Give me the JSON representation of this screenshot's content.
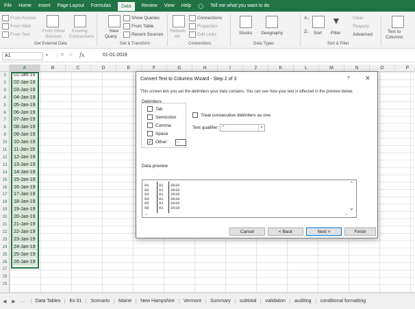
{
  "ribbon_tabs": [
    "File",
    "Home",
    "Insert",
    "Page Layout",
    "Formulas",
    "Data",
    "Review",
    "View",
    "Help"
  ],
  "tellme": "Tell me what you want to do",
  "ribbon": {
    "from_access": "From Access",
    "from_web": "From Web",
    "from_text": "From Text",
    "from_other": "From Other",
    "sources": "Sources",
    "existing": "Existing",
    "connections_btn": "Connections",
    "new_query": "New",
    "query": "Query",
    "show_queries": "Show Queries",
    "from_table": "From Table",
    "recent_sources": "Recent Sources",
    "refresh": "Refresh",
    "all": "All",
    "connections": "Connections",
    "properties": "Properties",
    "edit_links": "Edit Links",
    "stocks": "Stocks",
    "geography": "Geography",
    "sort": "Sort",
    "filter": "Filter",
    "clear": "Clear",
    "reapply": "Reapply",
    "advanced": "Advanced",
    "text_to": "Text to",
    "columns": "Columns",
    "group_get_external": "Get External Data",
    "group_get_transform": "Get & Transform",
    "group_connections": "Connections",
    "group_data_types": "Data Types",
    "group_sort_filter": "Sort & Filter"
  },
  "namebox": "A1",
  "formula_value": "01-01-2019",
  "columns": [
    "A",
    "B",
    "C",
    "D",
    "E",
    "F",
    "G",
    "H",
    "I",
    "J",
    "K",
    "L",
    "M",
    "N",
    "O",
    "P"
  ],
  "rows": [
    "1",
    "2",
    "3",
    "4",
    "5",
    "6",
    "7",
    "8",
    "9",
    "10",
    "11",
    "12",
    "13",
    "14",
    "15",
    "16",
    "17",
    "18",
    "19",
    "20",
    "21",
    "22",
    "23",
    "24",
    "25",
    "26",
    "27",
    "28",
    "29"
  ],
  "cells": [
    "01-Jan-19",
    "02-Jan-19",
    "03-Jan-19",
    "04-Jan-19",
    "05-Jan-19",
    "06-Jan-19",
    "07-Jan-19",
    "08-Jan-19",
    "09-Jan-19",
    "10-Jan-19",
    "11-Jan-19",
    "12-Jan-19",
    "13-Jan-19",
    "14-Jan-19",
    "15-Jan-19",
    "16-Jan-19",
    "17-Jan-19",
    "18-Jan-19",
    "19-Jan-19",
    "20-Jan-19",
    "21-Jan-19",
    "22-Jan-19",
    "23-Jan-19",
    "24-Jan-19",
    "25-Jan-19",
    "26-Jan-19"
  ],
  "dialog": {
    "title": "Convert Text to Columns Wizard - Step 2 of 3",
    "help": "?",
    "close": "✕",
    "description": "This screen lets you set the delimiters your data contains.  You can see how your text is affected in the preview below.",
    "delimiters_label": "Delimiters",
    "tab": "Tab",
    "semicolon": "Semicolon",
    "comma": "Comma",
    "space": "Space",
    "other": "Other:",
    "other_value": "-",
    "treat_consecutive": "Treat consecutive delimiters as one",
    "text_qualifier_label": "Text qualifier:",
    "text_qualifier_value": "\"",
    "preview_label": "Data preview",
    "preview_rows": [
      [
        "01",
        "01",
        "2019"
      ],
      [
        "02",
        "01",
        "2019"
      ],
      [
        "03",
        "01",
        "2019"
      ],
      [
        "04",
        "01",
        "2019"
      ],
      [
        "05",
        "01",
        "2019"
      ],
      [
        "06",
        "01",
        "2019"
      ]
    ],
    "cancel": "Cancel",
    "back": "< Back",
    "next": "Next >",
    "finish": "Finish"
  },
  "sheet_tabs": [
    "Data Tables",
    "Ex 01",
    "Scenario",
    "Maine",
    "New Hampshire",
    "Vermont",
    "Summary",
    "subtotal",
    "validation",
    "auditing",
    "conditional formatting"
  ],
  "colors": {
    "excel_green": "#217346",
    "selection_fill": "#d9e8d9"
  }
}
